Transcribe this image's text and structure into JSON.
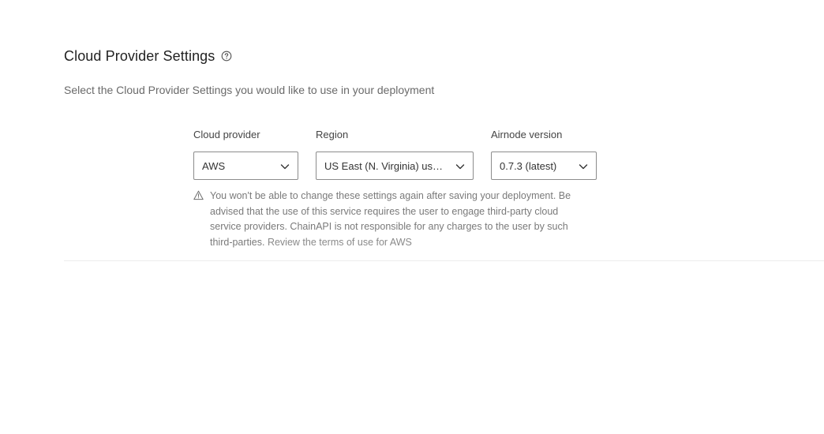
{
  "section": {
    "title": "Cloud Provider Settings",
    "help_icon": "question-circle-icon",
    "subtitle": "Select the Cloud Provider Settings you would like to use in your deployment"
  },
  "fields": {
    "cloud_provider": {
      "label": "Cloud provider",
      "value": "AWS",
      "icon": "chevron-down-icon"
    },
    "region": {
      "label": "Region",
      "value": "US East (N. Virginia) us-e...",
      "icon": "chevron-down-icon"
    },
    "airnode_version": {
      "label": "Airnode version",
      "value": "0.7.3 (latest)",
      "icon": "chevron-down-icon"
    }
  },
  "warning": {
    "icon": "warning-triangle-icon",
    "line1": "You won't be able to change these settings again after saving your deployment. Be",
    "line2": "advised that the use of this service requires the user to engage third-party cloud",
    "line3": "service providers. ChainAPI is not responsible for any charges to the user by such",
    "line4_prefix": "third-parties. ",
    "link": "Review the terms of use for AWS"
  },
  "colors": {
    "border": "#8c8c8c",
    "muted_text": "#7a7a7a",
    "divider": "#ececec"
  }
}
